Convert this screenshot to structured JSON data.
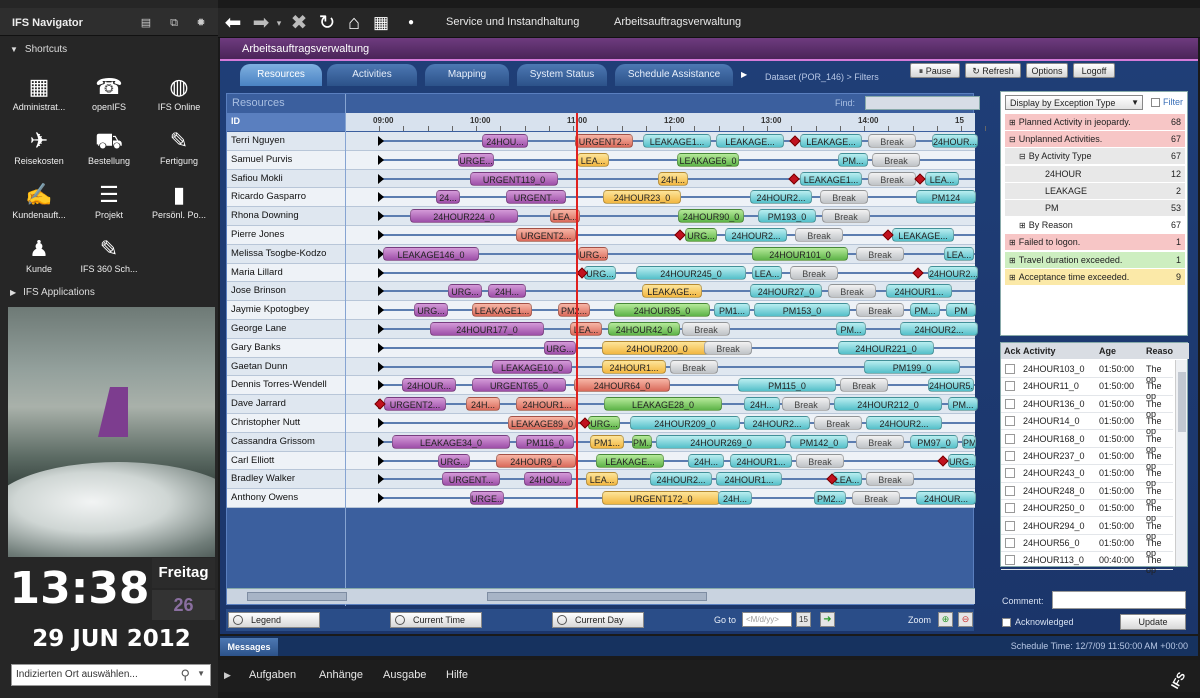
{
  "navigator": {
    "title": "IFS Navigator",
    "shortcuts_title": "Shortcuts",
    "applications_title": "IFS Applications",
    "shortcuts": [
      {
        "label": "Administrat...",
        "icon": "building-icon",
        "glyph": "▦"
      },
      {
        "label": "openIFS",
        "icon": "people-speech-icon",
        "glyph": "☎"
      },
      {
        "label": "IFS Online",
        "icon": "globe-icon",
        "glyph": "◍"
      },
      {
        "label": "Reisekosten",
        "icon": "plane-icon",
        "glyph": "✈"
      },
      {
        "label": "Bestellung",
        "icon": "shopping-cart-icon",
        "glyph": "⛟"
      },
      {
        "label": "Fertigung",
        "icon": "wrench-icon",
        "glyph": "✎"
      },
      {
        "label": "Kundenauft...",
        "icon": "edit-document-icon",
        "glyph": "✍"
      },
      {
        "label": "Projekt",
        "icon": "checklist-icon",
        "glyph": "☰"
      },
      {
        "label": "Persönl. Po...",
        "icon": "bar-chart-icon",
        "glyph": "▮"
      },
      {
        "label": "Kunde",
        "icon": "customers-icon",
        "glyph": "♟"
      },
      {
        "label": "IFS 360 Sch...",
        "icon": "wrench-icon",
        "glyph": "✎"
      }
    ],
    "clock": "13:38",
    "day": "Freitag",
    "day_number": "26",
    "date": "29 JUN 2012",
    "location_placeholder": "Indizierten Ort auswählen..."
  },
  "toolbar": {
    "crumbs": [
      "Service und Instandhaltung",
      "Arbeitsauftragsverwaltung"
    ]
  },
  "app": {
    "title": "Arbeitsauftragsverwaltung",
    "tabs": [
      "Resources",
      "Activities",
      "Mapping",
      "System Status",
      "Schedule Assistance"
    ],
    "active_tab": "Resources",
    "dataset": "Dataset (POR_146) > Filters",
    "buttons": {
      "pause": "Pause",
      "refresh": "Refresh",
      "options": "Options",
      "logoff": "Logoff"
    }
  },
  "gantt": {
    "panel_title": "Resources",
    "find_label": "Find:",
    "id_header": "ID",
    "times": [
      "09:00",
      "10:00",
      "11:00",
      "12:00",
      "13:00",
      "14:00",
      "15"
    ],
    "resources": [
      "Terri Nguyen",
      "Samuel Purvis",
      "Safiou Mokli",
      "Ricardo Gasparro",
      "Rhona Downing",
      "Pierre Jones",
      "Melissa Tsogbe-Kodzo",
      "Maria Lillard",
      "Jose Brinson",
      "Jaymie Kpotogbey",
      "George Lane",
      "Gary Banks",
      "Gaetan Dunn",
      "Dennis Torres-Wendell",
      "Dave Jarrard",
      "Christopher Nutt",
      "Cassandra Grissom",
      "Carl Elliott",
      "Bradley Walker",
      "Anthony Owens"
    ],
    "bars": [
      [
        [
          "24HOU...",
          "purple",
          102,
          46
        ],
        [
          "URGENT2...",
          "salmon",
          195,
          58
        ],
        [
          "LEAKAGE1...",
          "teal",
          263,
          68
        ],
        [
          "LEAKAGE...",
          "teal",
          336,
          68
        ],
        [
          "LEAKAGE...",
          "teal",
          420,
          62
        ],
        [
          "Break",
          "brk",
          488,
          48
        ],
        [
          "24HOUR...",
          "teal",
          552,
          46
        ]
      ],
      [
        [
          "URGE...",
          "purple",
          78,
          36
        ],
        [
          "LEA...",
          "yellow",
          197,
          32
        ],
        [
          "LEAKAGE6_0",
          "green",
          297,
          62
        ],
        [
          "PM...",
          "teal",
          458,
          30
        ],
        [
          "Break",
          "brk",
          492,
          48
        ]
      ],
      [
        [
          "URGENT119_0",
          "purple",
          90,
          88
        ],
        [
          "24H...",
          "yellow",
          278,
          30
        ],
        [
          "LEAKAGE1...",
          "teal",
          420,
          62
        ],
        [
          "Break",
          "brk",
          488,
          48
        ],
        [
          "LEA...",
          "teal",
          545,
          34
        ]
      ],
      [
        [
          "24...",
          "purple",
          56,
          24
        ],
        [
          "URGENT...",
          "purple",
          126,
          60
        ],
        [
          "24HOUR23_0",
          "yellow",
          223,
          78
        ],
        [
          "24HOUR2...",
          "teal",
          370,
          62
        ],
        [
          "Break",
          "brk",
          440,
          48
        ],
        [
          "PM124",
          "teal",
          536,
          60
        ]
      ],
      [
        [
          "24HOUR224_0",
          "purple",
          30,
          108
        ],
        [
          "LEA...",
          "salmon",
          170,
          30
        ],
        [
          "24HOUR90_0",
          "green",
          298,
          66
        ],
        [
          "PM193_0",
          "teal",
          378,
          58
        ],
        [
          "Break",
          "brk",
          442,
          48
        ]
      ],
      [
        [
          "URGENT2...",
          "salmon",
          136,
          60
        ],
        [
          "URG...",
          "green",
          305,
          32
        ],
        [
          "24HOUR2...",
          "teal",
          345,
          62
        ],
        [
          "Break",
          "brk",
          415,
          48
        ],
        [
          "LEAKAGE...",
          "teal",
          512,
          62
        ]
      ],
      [
        [
          "LEAKAGE146_0",
          "purple",
          3,
          96
        ],
        [
          "URG...",
          "salmon",
          198,
          30
        ],
        [
          "24HOUR101_0",
          "green",
          372,
          96
        ],
        [
          "Break",
          "brk",
          476,
          48
        ],
        [
          "LEA...",
          "teal",
          564,
          30
        ]
      ],
      [
        [
          "URG...",
          "teal",
          204,
          32
        ],
        [
          "24HOUR245_0",
          "teal",
          256,
          110
        ],
        [
          "LEA...",
          "teal",
          372,
          30
        ],
        [
          "Break",
          "brk",
          410,
          48
        ],
        [
          "24HOUR2...",
          "teal",
          548,
          50
        ]
      ],
      [
        [
          "URG...",
          "purple",
          68,
          34
        ],
        [
          "24H...",
          "purple",
          108,
          38
        ],
        [
          "LEAKAGE...",
          "yellow",
          262,
          60
        ],
        [
          "24HOUR27_0",
          "teal",
          370,
          72
        ],
        [
          "Break",
          "brk",
          448,
          48
        ],
        [
          "24HOUR1...",
          "teal",
          506,
          66
        ]
      ],
      [
        [
          "URG...",
          "purple",
          34,
          34
        ],
        [
          "LEAKAGE1...",
          "salmon",
          92,
          60
        ],
        [
          "PM2...",
          "salmon",
          178,
          32
        ],
        [
          "24HOUR95_0",
          "green",
          234,
          96
        ],
        [
          "PM1...",
          "teal",
          334,
          36
        ],
        [
          "PM153_0",
          "teal",
          374,
          96
        ],
        [
          "Break",
          "brk",
          476,
          48
        ],
        [
          "PM...",
          "teal",
          530,
          30
        ],
        [
          "PM",
          "teal",
          566,
          30
        ]
      ],
      [
        [
          "24HOUR177_0",
          "purple",
          50,
          114
        ],
        [
          "LEA...",
          "salmon",
          190,
          32
        ],
        [
          "24HOUR42_0",
          "green",
          228,
          72
        ],
        [
          "Break",
          "brk",
          302,
          48
        ],
        [
          "PM...",
          "teal",
          456,
          30
        ],
        [
          "24HOUR2...",
          "teal",
          520,
          78
        ]
      ],
      [
        [
          "URG...",
          "purple",
          164,
          32
        ],
        [
          "24HOUR200_0",
          "yellow",
          222,
          110
        ],
        [
          "Break",
          "brk",
          324,
          48
        ],
        [
          "24HOUR221_0",
          "teal",
          458,
          96
        ]
      ],
      [
        [
          "LEAKAGE10_0",
          "purple",
          112,
          80
        ],
        [
          "24HOUR1...",
          "yellow",
          222,
          64
        ],
        [
          "Break",
          "brk",
          290,
          48
        ],
        [
          "PM199_0",
          "teal",
          484,
          96
        ]
      ],
      [
        [
          "24HOUR...",
          "purple",
          22,
          54
        ],
        [
          "URGENT65_0",
          "purple",
          92,
          94
        ],
        [
          "24HOUR64_0",
          "salmon",
          194,
          96
        ],
        [
          "PM115_0",
          "teal",
          358,
          98
        ],
        [
          "Break",
          "brk",
          460,
          48
        ],
        [
          "24HOUR5...",
          "teal",
          548,
          46
        ]
      ],
      [
        [
          "URGENT2...",
          "purple",
          4,
          62
        ],
        [
          "24H...",
          "salmon",
          86,
          34
        ],
        [
          "24HOUR1...",
          "salmon",
          136,
          62
        ],
        [
          "LEAKAGE28_0",
          "green",
          224,
          118
        ],
        [
          "24H...",
          "teal",
          364,
          36
        ],
        [
          "Break",
          "brk",
          402,
          48
        ],
        [
          "24HOUR212_0",
          "teal",
          454,
          108
        ],
        [
          "PM...",
          "teal",
          568,
          30
        ]
      ],
      [
        [
          "LEAKAGE89_0",
          "salmon",
          128,
          68
        ],
        [
          "URG...",
          "green",
          208,
          32
        ],
        [
          "24HOUR209_0",
          "teal",
          250,
          110
        ],
        [
          "24HOUR2...",
          "teal",
          364,
          66
        ],
        [
          "Break",
          "brk",
          434,
          48
        ],
        [
          "24HOUR2...",
          "teal",
          486,
          76
        ]
      ],
      [
        [
          "LEAKAGE34_0",
          "purple",
          12,
          118
        ],
        [
          "PM116_0",
          "purple",
          136,
          58
        ],
        [
          "PM1...",
          "yellow",
          210,
          34
        ],
        [
          "PM...",
          "green",
          252,
          20
        ],
        [
          "24HOUR269_0",
          "teal",
          276,
          130
        ],
        [
          "PM142_0",
          "teal",
          410,
          58
        ],
        [
          "Break",
          "brk",
          476,
          48
        ],
        [
          "PM97_0",
          "teal",
          530,
          48
        ],
        [
          "PM",
          "teal",
          582,
          14
        ]
      ],
      [
        [
          "URG...",
          "purple",
          58,
          32
        ],
        [
          "24HOUR9_0",
          "salmon",
          116,
          80
        ],
        [
          "LEAKAGE...",
          "green",
          216,
          68
        ],
        [
          "24H...",
          "teal",
          308,
          36
        ],
        [
          "24HOUR1...",
          "teal",
          350,
          62
        ],
        [
          "Break",
          "brk",
          416,
          48
        ],
        [
          "URG...",
          "teal",
          568,
          28
        ]
      ],
      [
        [
          "URGENT...",
          "purple",
          62,
          58
        ],
        [
          "24HOU...",
          "purple",
          144,
          48
        ],
        [
          "LEA...",
          "yellow",
          206,
          32
        ],
        [
          "24HOUR2...",
          "teal",
          270,
          62
        ],
        [
          "24HOUR1...",
          "teal",
          336,
          66
        ],
        [
          "LEA...",
          "teal",
          452,
          30
        ],
        [
          "Break",
          "brk",
          486,
          48
        ]
      ],
      [
        [
          "URGE...",
          "purple",
          90,
          34
        ],
        [
          "URGENT172_0",
          "yellow",
          222,
          118
        ],
        [
          "24H...",
          "teal",
          338,
          34
        ],
        [
          "PM2...",
          "teal",
          434,
          32
        ],
        [
          "Break",
          "brk",
          472,
          48
        ],
        [
          "24HOUR...",
          "teal",
          536,
          60
        ]
      ]
    ],
    "diamonds": [
      [
        0,
        415
      ],
      [
        2,
        414
      ],
      [
        2,
        540
      ],
      [
        5,
        300
      ],
      [
        5,
        508
      ],
      [
        7,
        202
      ],
      [
        7,
        538
      ],
      [
        14,
        0
      ],
      [
        15,
        205
      ],
      [
        17,
        563
      ],
      [
        18,
        452
      ]
    ],
    "footer": {
      "legend": "Legend",
      "current_time": "Current Time",
      "current_day": "Current Day",
      "goto": "Go to",
      "goto_placeholder": "<M/d/yy>",
      "zoom": "Zoom"
    }
  },
  "right_panel": {
    "display_select": "Display by Exception Type",
    "filter": "Filter",
    "exceptions": [
      {
        "label": "Planned Activity in jeopardy.",
        "count": "68",
        "color": "#f7c6c6",
        "indent": 0,
        "expander": "⊞"
      },
      {
        "label": "Unplanned Activities.",
        "count": "67",
        "color": "#f7c6c6",
        "indent": 0,
        "expander": "⊟"
      },
      {
        "label": "By Activity Type",
        "count": "67",
        "color": "#e8e8e8",
        "indent": 10,
        "expander": "⊟"
      },
      {
        "label": "24HOUR",
        "count": "12",
        "color": "#e8e8e8",
        "indent": 24,
        "expander": ""
      },
      {
        "label": "LEAKAGE",
        "count": "2",
        "color": "#e8e8e8",
        "indent": 24,
        "expander": ""
      },
      {
        "label": "PM",
        "count": "53",
        "color": "#e8e8e8",
        "indent": 24,
        "expander": ""
      },
      {
        "label": "By Reason",
        "count": "67",
        "color": "#ffffff",
        "indent": 10,
        "expander": "⊞"
      },
      {
        "label": "Failed to logon.",
        "count": "1",
        "color": "#f7c6c6",
        "indent": 0,
        "expander": "⊞"
      },
      {
        "label": "Travel duration exceeded.",
        "count": "1",
        "color": "#cdeec0",
        "indent": 0,
        "expander": "⊞"
      },
      {
        "label": "Acceptance time exceeded.",
        "count": "9",
        "color": "#fbe9a8",
        "indent": 0,
        "expander": "⊞"
      }
    ],
    "ack_headers": [
      "Ack",
      "Activity",
      "Age",
      "Reaso"
    ],
    "ack_rows": [
      [
        "24HOUR103_0",
        "01:50:00",
        "The op"
      ],
      [
        "24HOUR11_0",
        "01:50:00",
        "The op"
      ],
      [
        "24HOUR136_0",
        "01:50:00",
        "The op"
      ],
      [
        "24HOUR14_0",
        "01:50:00",
        "The op"
      ],
      [
        "24HOUR168_0",
        "01:50:00",
        "The op"
      ],
      [
        "24HOUR237_0",
        "01:50:00",
        "The op"
      ],
      [
        "24HOUR243_0",
        "01:50:00",
        "The op"
      ],
      [
        "24HOUR248_0",
        "01:50:00",
        "The op"
      ],
      [
        "24HOUR250_0",
        "01:50:00",
        "The op"
      ],
      [
        "24HOUR294_0",
        "01:50:00",
        "The op"
      ],
      [
        "24HOUR56_0",
        "01:50:00",
        "The op"
      ],
      [
        "24HOUR113_0",
        "00:40:00",
        "The op"
      ]
    ],
    "comment_label": "Comment:",
    "acknowledged_label": "Acknowledged",
    "update_label": "Update"
  },
  "messages": {
    "tab": "Messages",
    "schedule_time": "Schedule Time: 12/7/09 11:50:00 AM +00:00"
  },
  "bottom": {
    "items": [
      "Aufgaben",
      "Anhänge",
      "Ausgabe",
      "Hilfe"
    ],
    "logo": "IFS"
  }
}
